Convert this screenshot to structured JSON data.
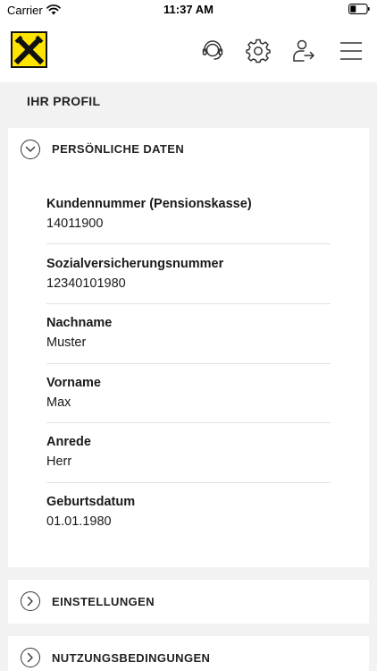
{
  "status_bar": {
    "carrier": "Carrier",
    "time": "11:37 AM"
  },
  "header": {
    "logo_icon": "raiffeisen-crossed-gables-logo",
    "actions": [
      {
        "icon": "headset-icon"
      },
      {
        "icon": "gear-icon"
      },
      {
        "icon": "user-logout-icon"
      },
      {
        "icon": "hamburger-menu-icon"
      }
    ]
  },
  "page": {
    "title": "IHR PROFIL"
  },
  "sections": {
    "personal": {
      "title": "PERSÖNLICHE DATEN",
      "expanded": true,
      "fields": [
        {
          "label": "Kundennummer (Pensionskasse)",
          "value": "14011900"
        },
        {
          "label": "Sozialversicherungsnummer",
          "value": "12340101980"
        },
        {
          "label": "Nachname",
          "value": "Muster"
        },
        {
          "label": "Vorname",
          "value": "Max"
        },
        {
          "label": "Anrede",
          "value": "Herr"
        },
        {
          "label": "Geburtsdatum",
          "value": "01.01.1980"
        }
      ]
    },
    "settings": {
      "title": "EINSTELLUNGEN",
      "expanded": false
    },
    "terms": {
      "title": "NUTZUNGSBEDINGUNGEN",
      "expanded": false
    }
  },
  "colors": {
    "brand_yellow": "#ffe500",
    "background": "#f2f2f2",
    "card": "#ffffff"
  }
}
